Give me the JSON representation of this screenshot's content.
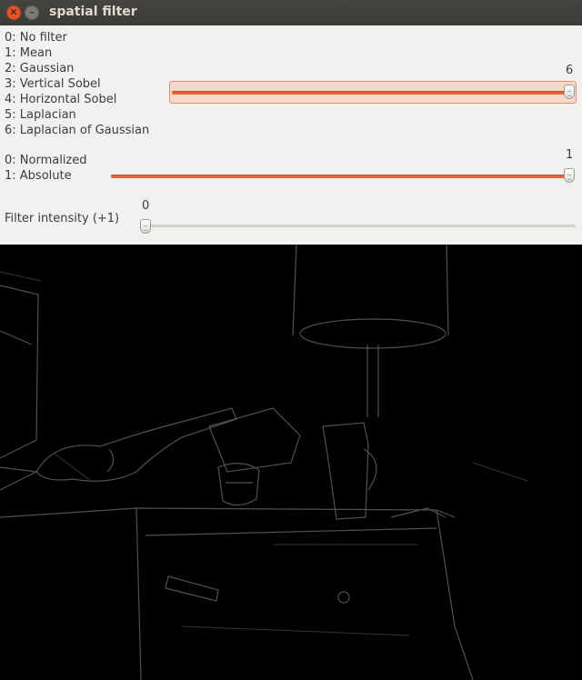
{
  "window": {
    "title": "spatial filter"
  },
  "filter": {
    "options": [
      "0: No filter",
      "1: Mean",
      "2: Gaussian",
      "3: Vertical Sobel",
      "4: Horizontal Sobel",
      "5: Laplacian",
      "6: Laplacian of Gaussian"
    ],
    "value": "6"
  },
  "mode": {
    "options": [
      "0: Normalized",
      "1: Absolute"
    ],
    "value": "1"
  },
  "intensity": {
    "label": "Filter intensity (+1)",
    "value": "0"
  },
  "colors": {
    "accent": "#e4663d",
    "panel": "#f2f1f0",
    "image_bg": "#000000"
  }
}
